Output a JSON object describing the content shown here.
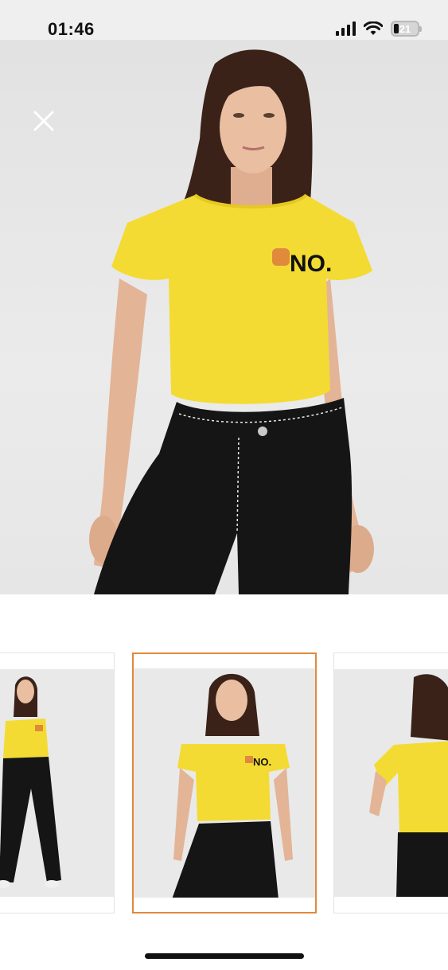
{
  "status_bar": {
    "time": "01:46",
    "battery_percent": "21",
    "battery_level": 0.21
  },
  "product_viewer": {
    "close_icon": "close-icon",
    "main_image": {
      "description_icon": "model-photo",
      "shirt_print_text": "NO."
    },
    "thumbnails": [
      {
        "name": "thumbnail-1",
        "selected": false
      },
      {
        "name": "thumbnail-2",
        "selected": true
      },
      {
        "name": "thumbnail-3",
        "selected": false
      }
    ]
  },
  "colors": {
    "selected_border": "#e08a3c",
    "shirt": "#f3db33",
    "jeans": "#151515",
    "background": "#e8e8e8"
  }
}
